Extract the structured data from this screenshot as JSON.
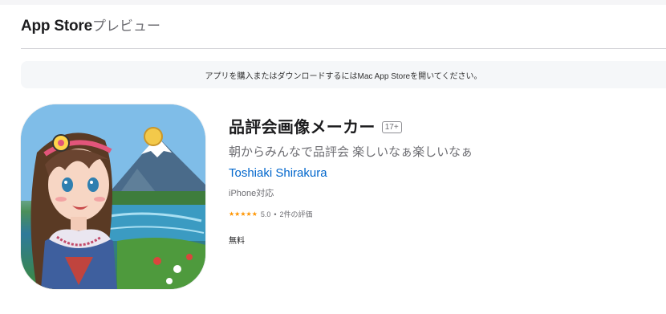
{
  "header": {
    "brand": "App Store",
    "preview_label": "プレビュー"
  },
  "banner": {
    "text": "アプリを購入またはダウンロードするにはMac App Storeを開いてください。"
  },
  "app": {
    "title": "品評会画像メーカー",
    "age_rating": "17+",
    "subtitle": "朝からみんなで品評会 楽しいなぁ楽しいなぁ",
    "developer": "Toshiaki Shirakura",
    "device": "iPhone対応",
    "stars": "★★★★★",
    "rating_value": "5.0",
    "rating_separator": "•",
    "rating_count": "2件の評価",
    "price": "無料"
  },
  "colors": {
    "accent_link": "#0066cc",
    "star": "#ff9500",
    "banner_bg": "#f5f7f9"
  },
  "icons": {
    "app_icon": "anime-girl-mountain-lake-icon"
  }
}
